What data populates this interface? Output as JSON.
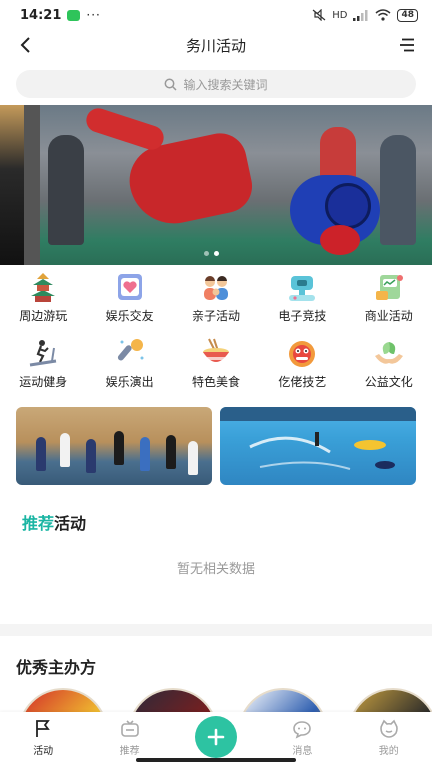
{
  "status_bar": {
    "time": "14:21",
    "dots": "···",
    "signal": "HD",
    "battery": "48"
  },
  "header": {
    "title": "务川活动"
  },
  "search": {
    "placeholder": "输入搜索关键词"
  },
  "categories": [
    {
      "label": "周边游玩",
      "icon": "pagoda-icon"
    },
    {
      "label": "娱乐交友",
      "icon": "heart-chat-icon"
    },
    {
      "label": "亲子活动",
      "icon": "family-icon"
    },
    {
      "label": "电子竞技",
      "icon": "gamepad-icon"
    },
    {
      "label": "商业活动",
      "icon": "briefcase-icon"
    },
    {
      "label": "运动健身",
      "icon": "treadmill-icon"
    },
    {
      "label": "娱乐演出",
      "icon": "microphone-icon"
    },
    {
      "label": "特色美食",
      "icon": "noodle-bowl-icon"
    },
    {
      "label": "仡佬技艺",
      "icon": "lion-dance-icon"
    },
    {
      "label": "公益文化",
      "icon": "hands-leaf-icon"
    }
  ],
  "recommend": {
    "title_highlight": "推荐",
    "title_rest": "活动",
    "empty_text": "暂无相关数据"
  },
  "organizers": {
    "title": "优秀主办方"
  },
  "bottom_nav": [
    {
      "label": "活动",
      "icon": "flag-icon",
      "active": true
    },
    {
      "label": "推荐",
      "icon": "tv-icon",
      "active": false
    },
    {
      "label": "",
      "icon": "plus-icon",
      "active": false
    },
    {
      "label": "消息",
      "icon": "chat-bubble-icon",
      "active": false
    },
    {
      "label": "我的",
      "icon": "smile-face-icon",
      "active": false
    }
  ],
  "colors": {
    "accent": "#2dc3a2",
    "highlight": "#1bb5a3"
  }
}
